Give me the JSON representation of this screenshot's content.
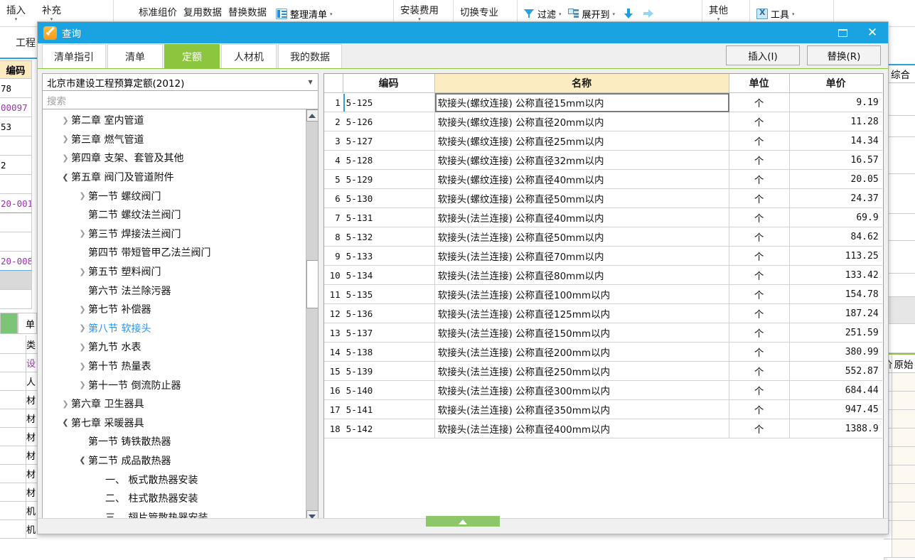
{
  "ribbon": {
    "groups": [
      {
        "items": [
          {
            "label": "插入",
            "icon": "caret-down-icon",
            "has_caret": true
          },
          {
            "label": "补充",
            "icon": "caret-down-icon",
            "has_caret": true
          }
        ]
      },
      {
        "items": [
          {
            "label": "标准组价",
            "has_caret": false
          },
          {
            "label": "复用数据",
            "has_caret": false
          },
          {
            "label": "替换数据",
            "has_caret": false
          },
          {
            "label": "整理清单",
            "icon": "list-icon",
            "has_caret": true
          }
        ]
      },
      {
        "items": [
          {
            "label": "安装费用",
            "has_caret": true
          }
        ]
      },
      {
        "items": [
          {
            "label": "切换专业",
            "has_caret": false
          }
        ]
      },
      {
        "items": [
          {
            "label": "过滤",
            "icon": "funnel-icon",
            "has_caret": true
          },
          {
            "label": "展开到",
            "icon": "expand-to-icon",
            "has_caret": true
          },
          {
            "label": "",
            "icon": "arrow-down-icon",
            "has_caret": false
          },
          {
            "label": "",
            "icon": "arrow-right-icon",
            "has_caret": false
          }
        ]
      },
      {
        "items": [
          {
            "label": "其他",
            "has_caret": true
          }
        ]
      },
      {
        "items": [
          {
            "label": "工具",
            "icon": "tool-icon",
            "has_caret": true
          }
        ]
      }
    ]
  },
  "background": {
    "left": {
      "tab_label": "工程",
      "column_header": "编码",
      "rows": [
        {
          "text": "78",
          "style": "plain"
        },
        {
          "text": "00097",
          "style": "purple"
        },
        {
          "text": "53",
          "style": "plain"
        },
        {
          "text": "",
          "style": "plain"
        },
        {
          "text": "2",
          "style": "plain"
        },
        {
          "text": "",
          "style": "plain"
        },
        {
          "text": "20-001",
          "style": "purple-blueline"
        },
        {
          "text": "",
          "style": "plain"
        },
        {
          "text": "",
          "style": "plain"
        },
        {
          "text": "20-008",
          "style": "purple"
        },
        {
          "text": "",
          "style": "gray"
        },
        {
          "text": "",
          "style": "plain"
        }
      ],
      "green_col_label": "单",
      "sub_rows": [
        {
          "text": "类",
          "style": "plain"
        },
        {
          "text": "设",
          "style": "purple"
        },
        {
          "text": "人",
          "style": "plain"
        },
        {
          "text": "材",
          "style": "plain"
        },
        {
          "text": "材",
          "style": "plain"
        },
        {
          "text": "材",
          "style": "plain"
        },
        {
          "text": "材",
          "style": "plain"
        },
        {
          "text": "材",
          "style": "plain"
        },
        {
          "text": "材",
          "style": "plain"
        },
        {
          "text": "机",
          "style": "plain"
        },
        {
          "text": "机",
          "style": "plain"
        }
      ]
    },
    "right": {
      "top_header": "综合",
      "second_header_left": "价",
      "second_header_right": "原始"
    }
  },
  "dialog": {
    "title": "查询",
    "title_icon": "query-app-icon",
    "window_buttons": {
      "minimize": "minimize-icon",
      "close": "close-icon"
    },
    "tabs": [
      {
        "label": "清单指引",
        "active": false
      },
      {
        "label": "清单",
        "active": false
      },
      {
        "label": "定额",
        "active": true
      },
      {
        "label": "人材机",
        "active": false
      },
      {
        "label": "我的数据",
        "active": false
      }
    ],
    "actions": [
      {
        "label": "插入(I)"
      },
      {
        "label": "替换(R)"
      }
    ],
    "left_pane": {
      "standard_select": {
        "value": "北京市建设工程预算定额(2012)",
        "caret": "chevron-down-icon"
      },
      "search": {
        "placeholder": "搜索",
        "value": ""
      },
      "tree": [
        {
          "indent": 1,
          "toggle": "collapsed",
          "label": "第二章 室内管道",
          "selected": false
        },
        {
          "indent": 1,
          "toggle": "collapsed",
          "label": "第三章 燃气管道",
          "selected": false
        },
        {
          "indent": 1,
          "toggle": "collapsed",
          "label": "第四章 支架、套管及其他",
          "selected": false
        },
        {
          "indent": 1,
          "toggle": "expanded",
          "label": "第五章 阀门及管道附件",
          "selected": false
        },
        {
          "indent": 2,
          "toggle": "collapsed",
          "label": "第一节 螺纹阀门",
          "selected": false
        },
        {
          "indent": 2,
          "toggle": "none",
          "label": "第二节 螺纹法兰阀门",
          "selected": false
        },
        {
          "indent": 2,
          "toggle": "collapsed",
          "label": "第三节 焊接法兰阀门",
          "selected": false
        },
        {
          "indent": 2,
          "toggle": "none",
          "label": "第四节 带短管甲乙法兰阀门",
          "selected": false
        },
        {
          "indent": 2,
          "toggle": "collapsed",
          "label": "第五节 塑料阀门",
          "selected": false
        },
        {
          "indent": 2,
          "toggle": "none",
          "label": "第六节 法兰除污器",
          "selected": false
        },
        {
          "indent": 2,
          "toggle": "collapsed",
          "label": "第七节 补偿器",
          "selected": false
        },
        {
          "indent": 2,
          "toggle": "collapsed",
          "label": "第八节 软接头",
          "selected": true
        },
        {
          "indent": 2,
          "toggle": "collapsed",
          "label": "第九节 水表",
          "selected": false
        },
        {
          "indent": 2,
          "toggle": "collapsed",
          "label": "第十节 热量表",
          "selected": false
        },
        {
          "indent": 2,
          "toggle": "collapsed",
          "label": "第十一节 倒流防止器",
          "selected": false
        },
        {
          "indent": 1,
          "toggle": "collapsed",
          "label": "第六章 卫生器具",
          "selected": false
        },
        {
          "indent": 1,
          "toggle": "expanded",
          "label": "第七章 采暖器具",
          "selected": false
        },
        {
          "indent": 2,
          "toggle": "none",
          "label": "第一节 铸铁散热器",
          "selected": false
        },
        {
          "indent": 2,
          "toggle": "expanded",
          "label": "第二节 成品散热器",
          "selected": false
        },
        {
          "indent": 3,
          "toggle": "none",
          "label": "一、 板式散热器安装",
          "selected": false
        },
        {
          "indent": 3,
          "toggle": "none",
          "label": "二、 柱式散热器安装",
          "selected": false
        },
        {
          "indent": 3,
          "toggle": "none",
          "label": "三、 翅片管散热器安装",
          "selected": false
        }
      ],
      "scrollbar": {
        "up": "scroll-up-icon",
        "down": "scroll-down-icon"
      }
    },
    "grid": {
      "columns": [
        "",
        "编码",
        "名称",
        "单位",
        "单价"
      ],
      "selected_row": 1,
      "rows": [
        {
          "n": "1",
          "code": "5-125",
          "name": "软接头(螺纹连接) 公称直径15mm以内",
          "unit": "个",
          "price": "9.19"
        },
        {
          "n": "2",
          "code": "5-126",
          "name": "软接头(螺纹连接) 公称直径20mm以内",
          "unit": "个",
          "price": "11.28"
        },
        {
          "n": "3",
          "code": "5-127",
          "name": "软接头(螺纹连接) 公称直径25mm以内",
          "unit": "个",
          "price": "14.34"
        },
        {
          "n": "4",
          "code": "5-128",
          "name": "软接头(螺纹连接) 公称直径32mm以内",
          "unit": "个",
          "price": "16.57"
        },
        {
          "n": "5",
          "code": "5-129",
          "name": "软接头(螺纹连接) 公称直径40mm以内",
          "unit": "个",
          "price": "20.05"
        },
        {
          "n": "6",
          "code": "5-130",
          "name": "软接头(螺纹连接) 公称直径50mm以内",
          "unit": "个",
          "price": "24.37"
        },
        {
          "n": "7",
          "code": "5-131",
          "name": "软接头(法兰连接) 公称直径40mm以内",
          "unit": "个",
          "price": "69.9"
        },
        {
          "n": "8",
          "code": "5-132",
          "name": "软接头(法兰连接) 公称直径50mm以内",
          "unit": "个",
          "price": "84.62"
        },
        {
          "n": "9",
          "code": "5-133",
          "name": "软接头(法兰连接) 公称直径70mm以内",
          "unit": "个",
          "price": "113.25"
        },
        {
          "n": "10",
          "code": "5-134",
          "name": "软接头(法兰连接) 公称直径80mm以内",
          "unit": "个",
          "price": "133.42"
        },
        {
          "n": "11",
          "code": "5-135",
          "name": "软接头(法兰连接) 公称直径100mm以内",
          "unit": "个",
          "price": "154.78"
        },
        {
          "n": "12",
          "code": "5-136",
          "name": "软接头(法兰连接) 公称直径125mm以内",
          "unit": "个",
          "price": "187.24"
        },
        {
          "n": "13",
          "code": "5-137",
          "name": "软接头(法兰连接) 公称直径150mm以内",
          "unit": "个",
          "price": "251.59"
        },
        {
          "n": "14",
          "code": "5-138",
          "name": "软接头(法兰连接) 公称直径200mm以内",
          "unit": "个",
          "price": "380.99"
        },
        {
          "n": "15",
          "code": "5-139",
          "name": "软接头(法兰连接) 公称直径250mm以内",
          "unit": "个",
          "price": "552.87"
        },
        {
          "n": "16",
          "code": "5-140",
          "name": "软接头(法兰连接) 公称直径300mm以内",
          "unit": "个",
          "price": "684.44"
        },
        {
          "n": "17",
          "code": "5-141",
          "name": "软接头(法兰连接) 公称直径350mm以内",
          "unit": "个",
          "price": "947.45"
        },
        {
          "n": "18",
          "code": "5-142",
          "name": "软接头(法兰连接) 公称直径400mm以内",
          "unit": "个",
          "price": "1388.9"
        }
      ]
    },
    "collapse_handle": {
      "icon": "chevron-up-icon"
    }
  },
  "colors": {
    "title_bar": "#19a3e0",
    "active_tab": "#8cc63f",
    "name_header": "#fbecc2",
    "selected_tree_item": "#2196f3",
    "collapse_handle": "#8cc76a"
  }
}
